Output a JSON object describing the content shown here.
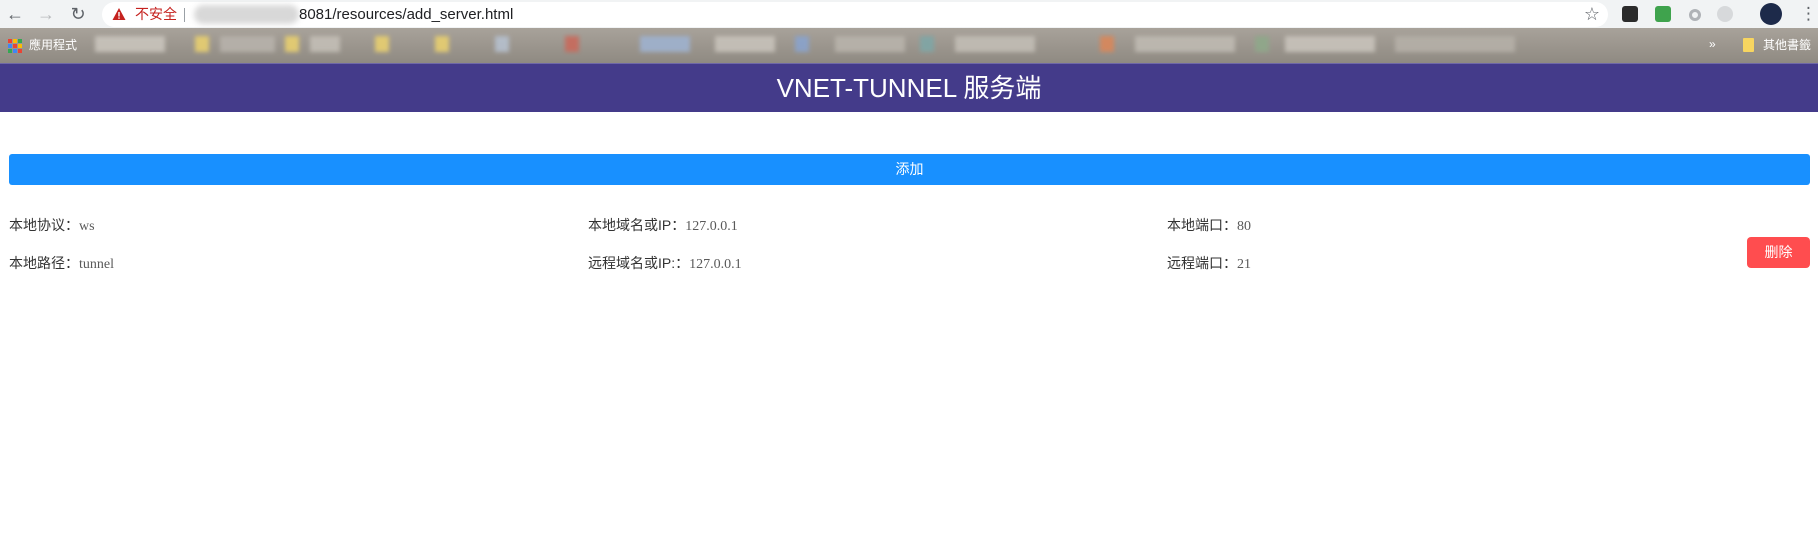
{
  "browser": {
    "url_text": "8081/resources/add_server.html",
    "security_label": "不安全",
    "bookmarks": {
      "apps_label": "應用程式",
      "other_label": "其他書籤",
      "more_label": "»"
    },
    "icons": [
      "back-arrow",
      "forward-arrow",
      "reload",
      "warning",
      "star",
      "menu-dots"
    ]
  },
  "header": {
    "title": "VNET-TUNNEL 服务端",
    "background": "#443b8a"
  },
  "actions": {
    "add_label": "添加",
    "add_color": "#1890ff",
    "delete_label": "删除",
    "delete_color": "#ff4d4f"
  },
  "server": {
    "local_protocol": {
      "label": "本地协议：",
      "value": "ws"
    },
    "local_host": {
      "label": "本地域名或IP：",
      "value": "127.0.0.1"
    },
    "local_port": {
      "label": "本地端口：",
      "value": "80"
    },
    "local_path": {
      "label": "本地路径：",
      "value": "tunnel"
    },
    "remote_host": {
      "label": "远程域名或IP:：",
      "value": "127.0.0.1"
    },
    "remote_port": {
      "label": "远程端口：",
      "value": "21"
    }
  }
}
